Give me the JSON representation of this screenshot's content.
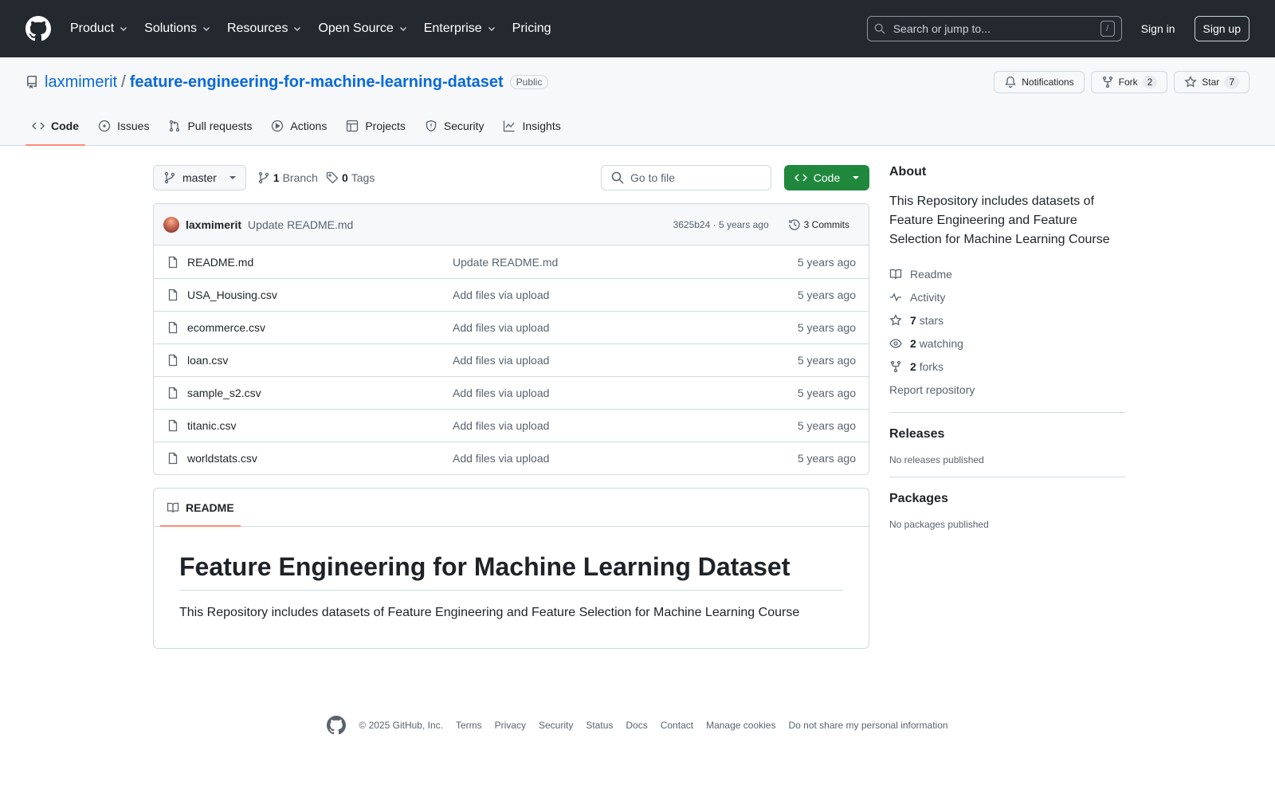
{
  "header": {
    "nav": [
      "Product",
      "Solutions",
      "Resources",
      "Open Source",
      "Enterprise",
      "Pricing"
    ],
    "search_placeholder": "Search or jump to...",
    "search_shortcut": "/",
    "sign_in": "Sign in",
    "sign_up": "Sign up"
  },
  "repo": {
    "owner": "laxmimerit",
    "separator": "/",
    "name": "feature-engineering-for-machine-learning-dataset",
    "visibility": "Public",
    "notifications": "Notifications",
    "fork_label": "Fork",
    "fork_count": "2",
    "star_label": "Star",
    "star_count": "7"
  },
  "tabs": [
    "Code",
    "Issues",
    "Pull requests",
    "Actions",
    "Projects",
    "Security",
    "Insights"
  ],
  "file_nav": {
    "branch": "master",
    "branch_count": "1",
    "branch_label": "Branch",
    "tag_count": "0",
    "tag_label": "Tags",
    "goto_placeholder": "Go to file",
    "code_button": "Code"
  },
  "commit": {
    "author": "laxmimerit",
    "message": "Update README.md",
    "meta": "3625b24 · 5 years ago",
    "commits": "3 Commits"
  },
  "files": [
    {
      "name": "README.md",
      "message": "Update README.md",
      "date": "5 years ago"
    },
    {
      "name": "USA_Housing.csv",
      "message": "Add files via upload",
      "date": "5 years ago"
    },
    {
      "name": "ecommerce.csv",
      "message": "Add files via upload",
      "date": "5 years ago"
    },
    {
      "name": "loan.csv",
      "message": "Add files via upload",
      "date": "5 years ago"
    },
    {
      "name": "sample_s2.csv",
      "message": "Add files via upload",
      "date": "5 years ago"
    },
    {
      "name": "titanic.csv",
      "message": "Add files via upload",
      "date": "5 years ago"
    },
    {
      "name": "worldstats.csv",
      "message": "Add files via upload",
      "date": "5 years ago"
    }
  ],
  "readme": {
    "tab": "README",
    "title": "Feature Engineering for Machine Learning Dataset",
    "body": "This Repository includes datasets of Feature Engineering and Feature Selection for Machine Learning Course"
  },
  "about": {
    "heading": "About",
    "description": "This Repository includes datasets of Feature Engineering and Feature Selection for Machine Learning Course",
    "readme": "Readme",
    "activity": "Activity",
    "stars_count": "7",
    "stars_label": "stars",
    "watching_count": "2",
    "watching_label": "watching",
    "forks_count": "2",
    "forks_label": "forks",
    "report": "Report repository"
  },
  "releases": {
    "heading": "Releases",
    "text": "No releases published"
  },
  "packages": {
    "heading": "Packages",
    "text": "No packages published"
  },
  "footer": {
    "copyright": "© 2025 GitHub, Inc.",
    "links": [
      "Terms",
      "Privacy",
      "Security",
      "Status",
      "Docs",
      "Contact",
      "Manage cookies",
      "Do not share my personal information"
    ]
  },
  "colors": {
    "header_bg": "#24292f",
    "link": "#0969da",
    "primary_button": "#1f883d",
    "tab_underline": "#fd8c73"
  }
}
